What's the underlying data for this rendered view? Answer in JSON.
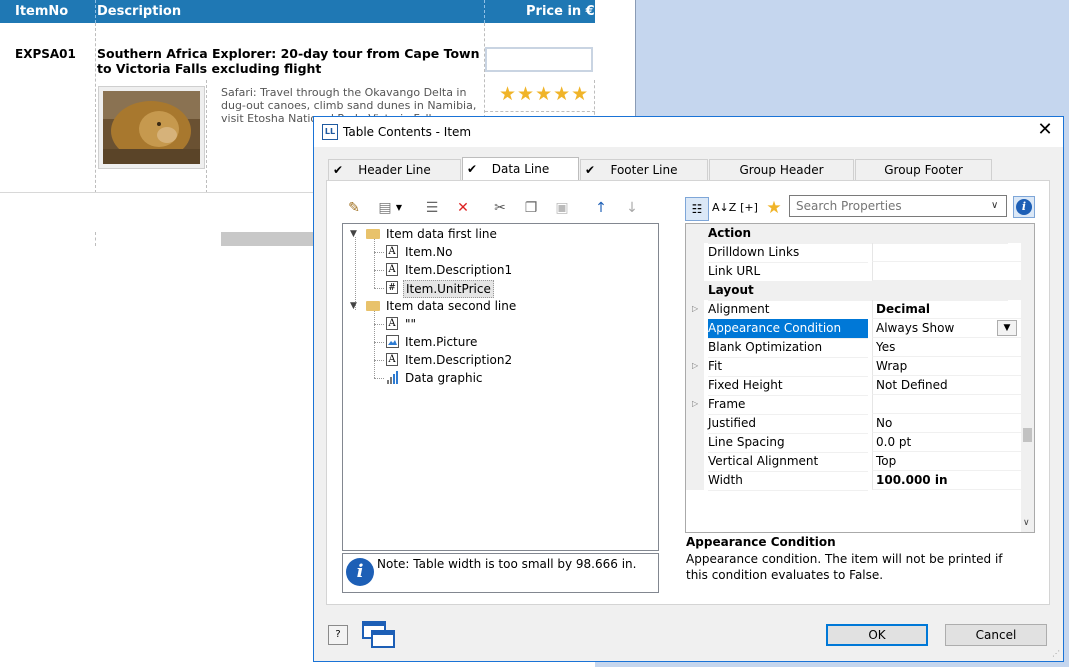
{
  "report": {
    "columns": [
      "ItemNo",
      "Description",
      "Price in €"
    ],
    "row": {
      "item_no": "EXPSA01",
      "title": "Southern Africa Explorer: 20-day tour from Cape Town to Victoria Falls excluding flight",
      "description": "Safari: Travel through the Okavango Delta in dug-out canoes, climb sand dunes in Namibia, visit Etosha National Park, Victoria Falls.",
      "rating_stars": "★★★★★",
      "rating_value": 5,
      "rating_max": 5
    },
    "colors": {
      "header_bg": "#1f78b4",
      "star": "#f0b429"
    }
  },
  "dialog": {
    "title": "Table Contents - Item",
    "title_icon": "LL",
    "close": "✕",
    "tabs": [
      {
        "label": "Header Line",
        "checked": true,
        "active": false
      },
      {
        "label": "Data Line",
        "checked": true,
        "active": true
      },
      {
        "label": "Footer Line",
        "checked": true,
        "active": false
      },
      {
        "label": "Group Header",
        "checked": false,
        "active": false
      },
      {
        "label": "Group Footer",
        "checked": false,
        "active": false
      }
    ],
    "check_glyph": "✔",
    "toolbar_icons": [
      "wand-icon",
      "new-field-icon",
      "properties-icon",
      "delete-icon",
      "cut-icon",
      "copy-icon",
      "paste-icon",
      "move-up-icon",
      "move-down-icon"
    ],
    "tree": {
      "groups": [
        {
          "label": "Item data first line",
          "children": [
            {
              "label": "Item.No",
              "icon": "A"
            },
            {
              "label": "Item.Description1",
              "icon": "A"
            },
            {
              "label": "Item.UnitPrice",
              "icon": "#",
              "selected": true
            }
          ]
        },
        {
          "label": "Item data second line",
          "children": [
            {
              "label": "\"\"",
              "icon": "A"
            },
            {
              "label": "Item.Picture",
              "icon": "picture"
            },
            {
              "label": "Item.Description2",
              "icon": "A"
            },
            {
              "label": "Data graphic",
              "icon": "chart"
            }
          ]
        }
      ]
    },
    "note": "Note: Table width is too small by 98.666 in.",
    "search_placeholder": "Search Properties",
    "property_toolbar": {
      "sort_az": "A↓Z",
      "expand": "[+]"
    },
    "properties": [
      {
        "group": "Action"
      },
      {
        "name": "Drilldown Links",
        "value": ""
      },
      {
        "name": "Link URL",
        "value": ""
      },
      {
        "group": "Layout"
      },
      {
        "name": "Alignment",
        "value": "Decimal",
        "expandable": true,
        "bold": true
      },
      {
        "name": "Appearance Condition",
        "value": "Always Show",
        "selected": true,
        "dropdown": true
      },
      {
        "name": "Blank Optimization",
        "value": "Yes"
      },
      {
        "name": "Fit",
        "value": "Wrap",
        "expandable": true
      },
      {
        "name": "Fixed Height",
        "value": "Not Defined"
      },
      {
        "name": "Frame",
        "value": "",
        "expandable": true
      },
      {
        "name": "Justified",
        "value": "No"
      },
      {
        "name": "Line Spacing",
        "value": "0.0 pt"
      },
      {
        "name": "Vertical Alignment",
        "value": "Top"
      },
      {
        "name": "Width",
        "value": "100.000 in",
        "bold": true
      }
    ],
    "description_title": "Appearance Condition",
    "description_text": "Appearance condition. The item will not be printed if this condition evaluates to False.",
    "buttons": {
      "ok": "OK",
      "cancel": "Cancel"
    },
    "colors": {
      "selection": "#0078d7",
      "default_border": "#0078d7"
    }
  }
}
